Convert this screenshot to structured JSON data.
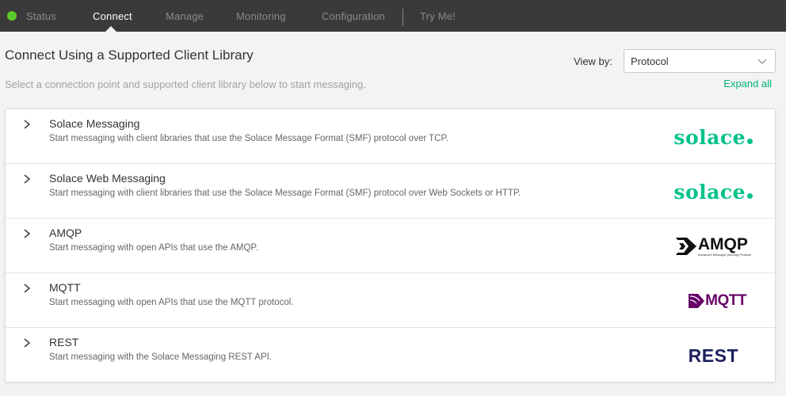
{
  "nav": {
    "status_color": "#5ec928",
    "items": [
      {
        "label": "Status",
        "active": false
      },
      {
        "label": "Connect",
        "active": true
      },
      {
        "label": "Manage",
        "active": false
      },
      {
        "label": "Monitoring",
        "active": false
      },
      {
        "label": "Configuration",
        "active": false
      },
      {
        "label": "Try Me!",
        "active": false
      }
    ]
  },
  "header": {
    "title": "Connect Using a Supported Client Library",
    "subtitle": "Select a connection point and supported client library below to start messaging.",
    "view_by_label": "View by:",
    "view_by_value": "Protocol",
    "expand_all": "Expand all"
  },
  "protocols": [
    {
      "title": "Solace Messaging",
      "description": "Start messaging with client libraries that use the Solace Message Format (SMF) protocol over TCP.",
      "logo_text": "solace",
      "logo_color": "#00c28a"
    },
    {
      "title": "Solace Web Messaging",
      "description": "Start messaging with client libraries that use the Solace Message Format (SMF) protocol over Web Sockets or HTTP.",
      "logo_text": "solace",
      "logo_color": "#00c28a"
    },
    {
      "title": "AMQP",
      "description": "Start messaging with open APIs that use the AMQP.",
      "logo_text": "AMQP",
      "logo_subtext": "Advanced Message Queuing Protocol",
      "logo_color": "#111111"
    },
    {
      "title": "MQTT",
      "description": "Start messaging with open APIs that use the MQTT protocol.",
      "logo_text": "MQTT",
      "logo_color": "#660066"
    },
    {
      "title": "REST",
      "description": "Start messaging with the Solace Messaging REST API.",
      "logo_text": "REST",
      "logo_color": "#1a1f5c"
    }
  ],
  "colors": {
    "accent": "#00b37e",
    "topbar": "#3a3a3a"
  }
}
